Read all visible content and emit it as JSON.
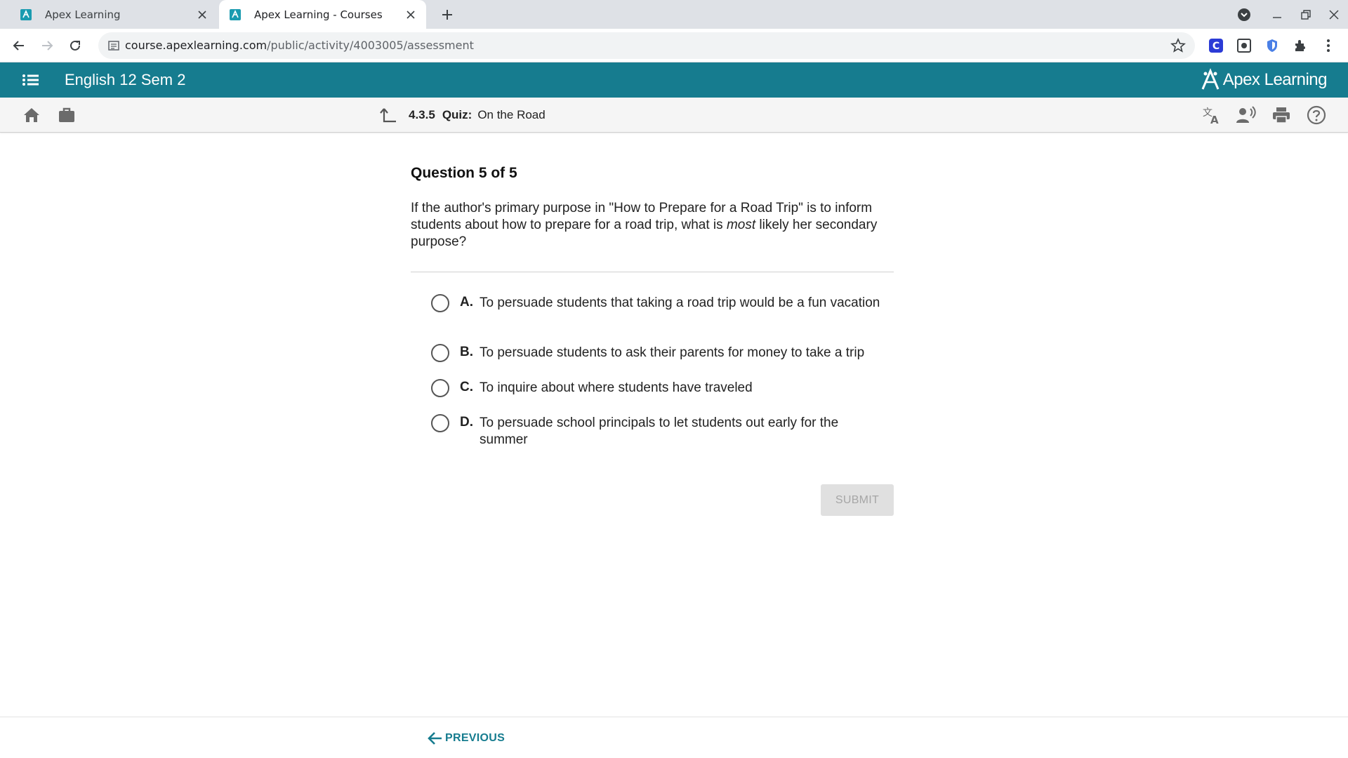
{
  "browser": {
    "tabs": [
      {
        "title": "Apex Learning",
        "active": false
      },
      {
        "title": "Apex Learning - Courses",
        "active": true
      }
    ],
    "url_domain": "course.apexlearning.com",
    "url_path": "/public/activity/4003005/assessment"
  },
  "app": {
    "course_title": "English 12 Sem 2",
    "brand_name": "Apex Learning",
    "accent_color": "#167c8f"
  },
  "breadcrumb": {
    "number": "4.3.5",
    "kind": "Quiz:",
    "title": "On the Road"
  },
  "question": {
    "heading": "Question 5 of 5",
    "text_before": "If the author's primary purpose in \"How to Prepare for a Road Trip\" is to inform students about how to prepare for a road trip, what is ",
    "text_emphasis": "most",
    "text_after": " likely her secondary purpose?",
    "options": [
      {
        "letter": "A.",
        "text": "To persuade students that taking a road trip would be a fun vacation"
      },
      {
        "letter": "B.",
        "text": "To persuade students to ask their parents for money to take a trip"
      },
      {
        "letter": "C.",
        "text": "To inquire about where students have traveled"
      },
      {
        "letter": "D.",
        "text": "To persuade school principals to let students out early for the summer"
      }
    ]
  },
  "actions": {
    "submit_label": "SUBMIT",
    "previous_label": "PREVIOUS"
  }
}
